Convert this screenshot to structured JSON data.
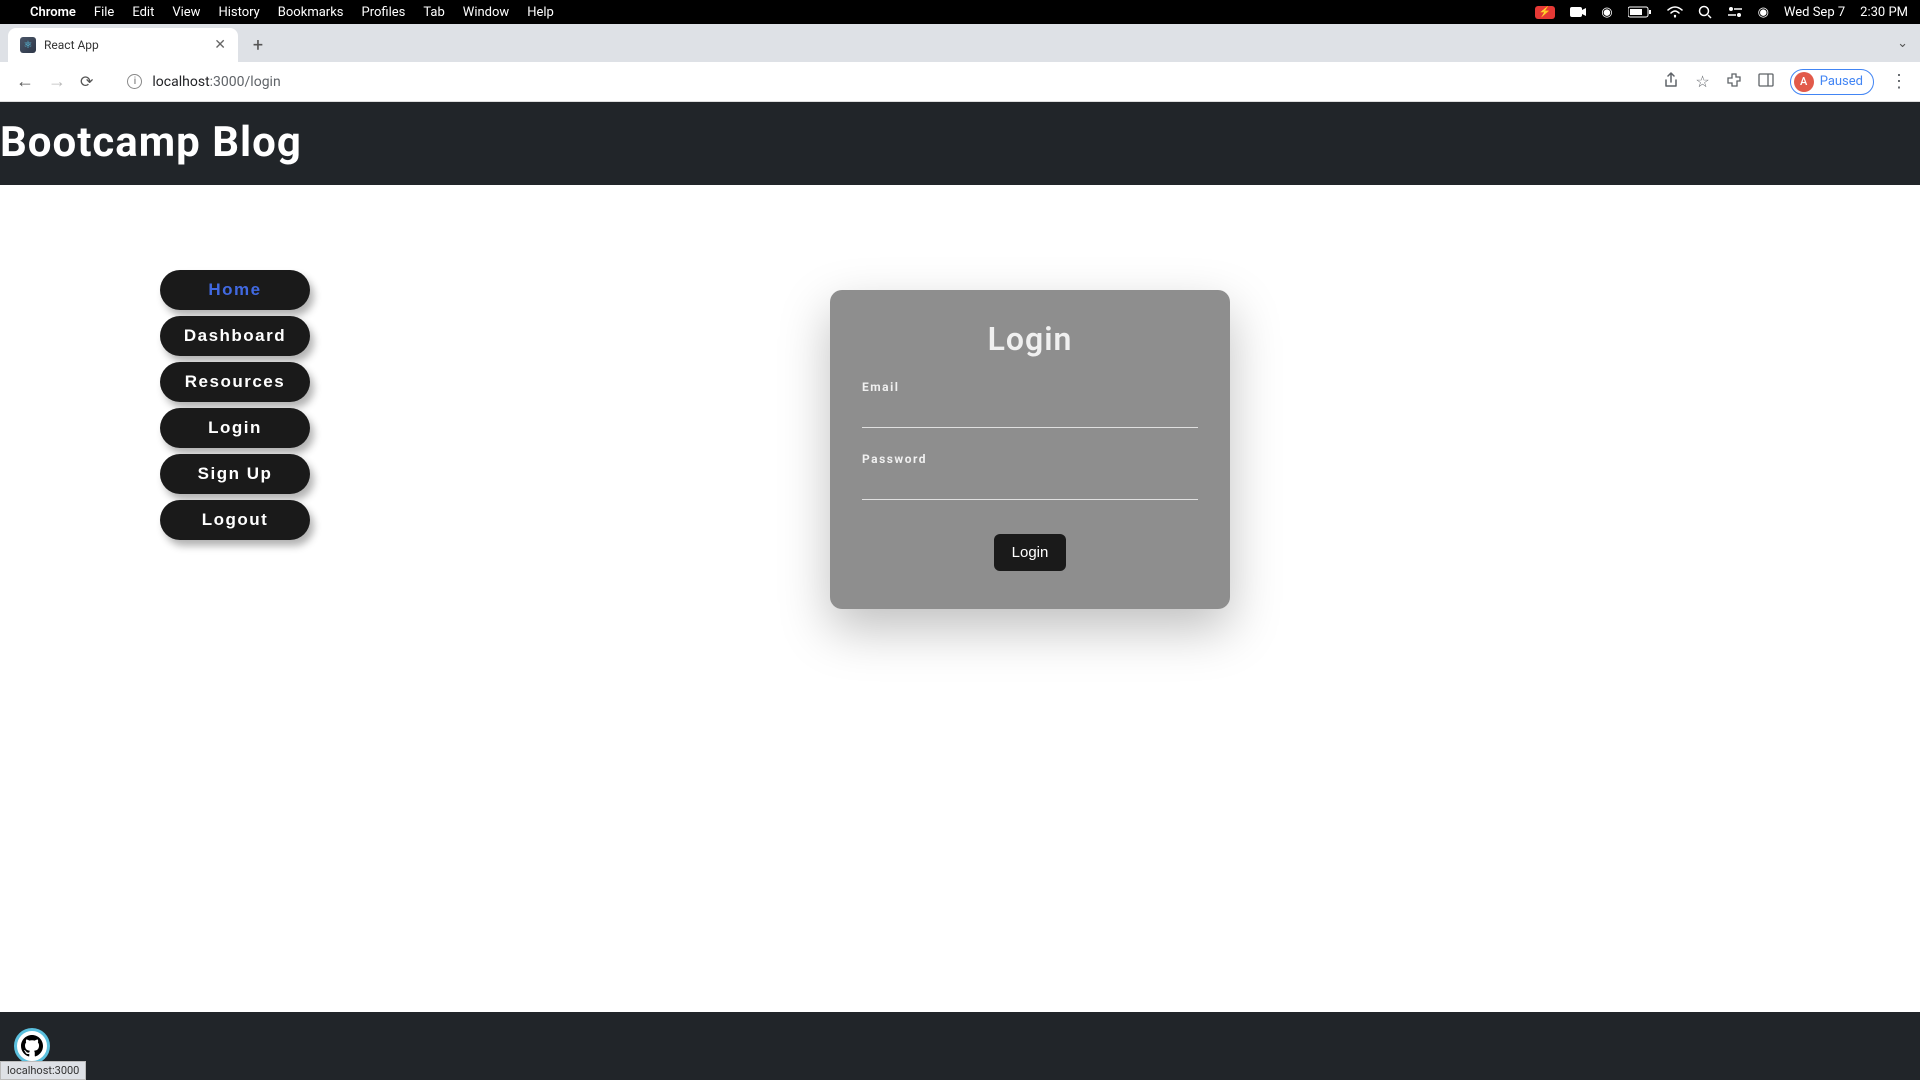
{
  "macos": {
    "app_name": "Chrome",
    "menus": [
      "File",
      "Edit",
      "View",
      "History",
      "Bookmarks",
      "Profiles",
      "Tab",
      "Window",
      "Help"
    ],
    "date": "Wed Sep 7",
    "time": "2:30 PM"
  },
  "browser": {
    "tab_title": "React App",
    "url_host": "localhost",
    "url_port": ":3000",
    "url_path": "/login",
    "profile_initial": "A",
    "profile_status": "Paused"
  },
  "app": {
    "header_title": "Bootcamp Blog",
    "nav": [
      {
        "label": "Home",
        "active": true
      },
      {
        "label": "Dashboard",
        "active": false
      },
      {
        "label": "Resources",
        "active": false
      },
      {
        "label": "Login",
        "active": false
      },
      {
        "label": "Sign Up",
        "active": false
      },
      {
        "label": "Logout",
        "active": false
      }
    ],
    "login_card": {
      "title": "Login",
      "email_label": "Email",
      "password_label": "Password",
      "submit_label": "Login"
    },
    "footer_status": "localhost:3000"
  }
}
